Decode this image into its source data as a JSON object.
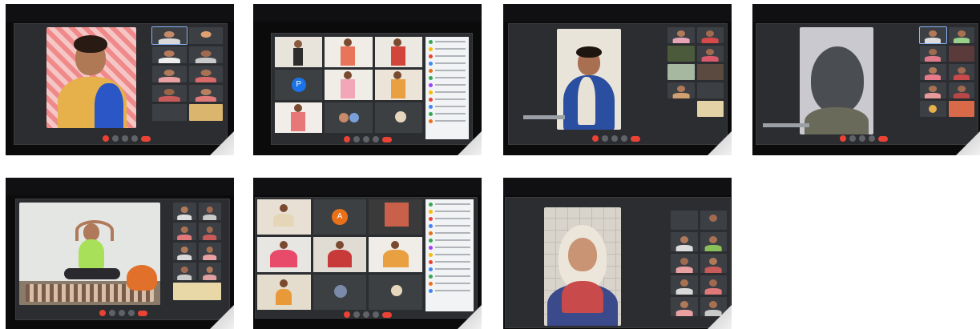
{
  "collage": {
    "screens": [
      {
        "id": "screen-1",
        "layout": "speaker-with-strip"
      },
      {
        "id": "screen-2",
        "layout": "gallery-with-chat"
      },
      {
        "id": "screen-3",
        "layout": "speaker-with-strip"
      },
      {
        "id": "screen-4",
        "layout": "speaker-with-strip"
      },
      {
        "id": "screen-5",
        "layout": "speaker-with-strip"
      },
      {
        "id": "screen-6",
        "layout": "gallery-with-chat"
      },
      {
        "id": "screen-7",
        "layout": "speaker-with-strip"
      }
    ],
    "avatars": {
      "screen2_p": "P",
      "screen6_a": "A"
    },
    "colors": {
      "meet_end_call": "#ea4335",
      "bezel": "#0b0b0c",
      "screen_bg": "#2b2d31",
      "avatar_blue": "#1a73e8",
      "avatar_orange": "#e8711a"
    }
  }
}
